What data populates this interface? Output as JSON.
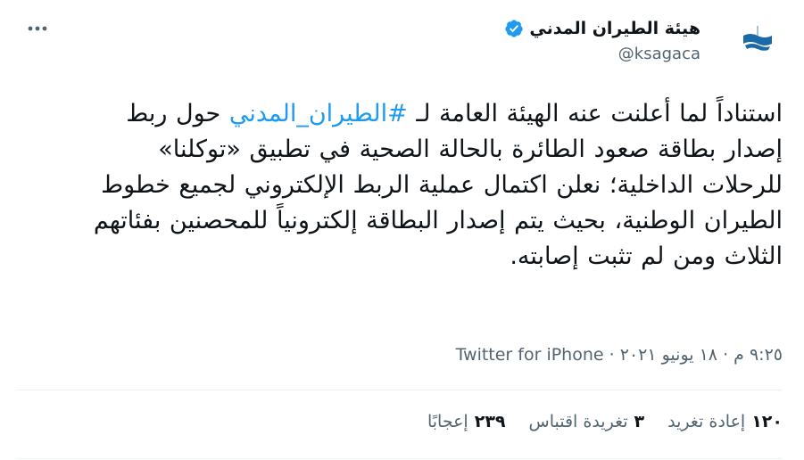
{
  "account": {
    "display_name": "هيئة الطيران المدني",
    "handle": "@ksagaca"
  },
  "tweet": {
    "text_before_hashtag": "استناداً لما أعلنت عنه الهيئة العامة لـ ",
    "hashtag": "#الطيران_المدني",
    "text_after_hashtag": " حول ربط إصدار بطاقة صعود الطائرة بالحالة الصحية في تطبيق «توكلنا» للرحلات الداخلية؛ نعلن اكتمال عملية الربط الإلكتروني لجميع خطوط الطيران الوطنية، بحيث يتم إصدار البطاقة إلكترونياً للمحصنين بفئاتهم الثلاث ومن لم تثبت إصابته."
  },
  "meta": {
    "time": "٩:٢٥ م",
    "separator": "·",
    "date": "١٨ يونيو ٢٠٢١",
    "source": "Twitter for iPhone"
  },
  "stats": {
    "retweets": {
      "count": "١٢٠",
      "label": "إعادة تغريد"
    },
    "quotes": {
      "count": "٣",
      "label": "تغريدة اقتباس"
    },
    "likes": {
      "count": "٢٣٩",
      "label": "إعجابًا"
    }
  },
  "icons": {
    "more": "more-horizontal-icon",
    "verified": "verified-badge-icon",
    "avatar": "gaca-logo"
  },
  "colors": {
    "link": "#1d9bf0",
    "verified": "#1d9bf0",
    "secondary_text": "#536471",
    "logo_blue": "#1a6aa8"
  }
}
